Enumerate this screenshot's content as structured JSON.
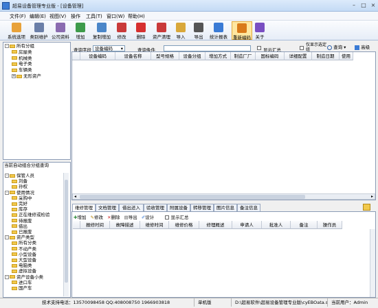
{
  "window": {
    "title": "超易设备管理专业版 - [设备管理]",
    "controls": [
      "–",
      "□",
      "×"
    ]
  },
  "menu": [
    "文件(F)",
    "编辑(E)",
    "视图(V)",
    "操作",
    "工具(T)",
    "窗口(W)",
    "帮助(H)"
  ],
  "toolbar": [
    {
      "label": "系统选项",
      "icon": "system-options-icon",
      "color": "#e8a23a"
    },
    {
      "label": "类别维护",
      "icon": "category-maintain-icon",
      "color": "#6b7fa8"
    },
    {
      "label": "公司资料",
      "icon": "company-info-icon",
      "color": "#8a6bb0"
    },
    {
      "label": "增加",
      "icon": "add-icon",
      "color": "#3d9b4b"
    },
    {
      "label": "复制增加",
      "icon": "copy-add-icon",
      "color": "#4a86c9"
    },
    {
      "label": "修改",
      "icon": "edit-icon",
      "color": "#c93a3a"
    },
    {
      "label": "删除",
      "icon": "delete-icon",
      "color": "#d63030"
    },
    {
      "label": "资产清理",
      "icon": "asset-clean-icon",
      "color": "#c93a3a"
    },
    {
      "label": "导入",
      "icon": "import-icon",
      "color": "#d9a83a"
    },
    {
      "label": "导出",
      "icon": "export-icon",
      "color": "#555555"
    },
    {
      "label": "统计报表",
      "icon": "report-icon",
      "color": "#3a7bd5"
    },
    {
      "label": "重新编码",
      "icon": "recode-icon",
      "color": "#d97a1a",
      "active": true
    },
    {
      "label": "关于",
      "icon": "help-icon",
      "color": "#7a4fc2"
    }
  ],
  "tree_top": [
    {
      "label": "所有分组",
      "level": 0,
      "exp": "-"
    },
    {
      "label": "房屋类",
      "level": 1
    },
    {
      "label": "机械类",
      "level": 1
    },
    {
      "label": "电子类",
      "level": 1
    },
    {
      "label": "车辆类",
      "level": 1
    },
    {
      "label": "无形资产",
      "level": 1,
      "exp": "+"
    }
  ],
  "tree_bottom_title": "当前自动组合分组查询",
  "tree_bottom": [
    {
      "label": "保管人员",
      "level": 0,
      "exp": "-"
    },
    {
      "label": "刘备",
      "level": 1
    },
    {
      "label": "孙权",
      "level": 1
    },
    {
      "label": "使用情况",
      "level": 0,
      "exp": "-"
    },
    {
      "label": "采购中",
      "level": 1
    },
    {
      "label": "完好",
      "level": 1
    },
    {
      "label": "库存",
      "level": 1
    },
    {
      "label": "正在维修或检验",
      "level": 1
    },
    {
      "label": "待报废",
      "level": 1
    },
    {
      "label": "借出",
      "level": 1
    },
    {
      "label": "已报废",
      "level": 1
    },
    {
      "label": "资产类型",
      "level": 0,
      "exp": "-"
    },
    {
      "label": "所有分类",
      "level": 1
    },
    {
      "label": "不动产类",
      "level": 1
    },
    {
      "label": "小型设备",
      "level": 1
    },
    {
      "label": "大型设备",
      "level": 1
    },
    {
      "label": "电脑类",
      "level": 1
    },
    {
      "label": "虚拟设备",
      "level": 1
    },
    {
      "label": "资产设备小类",
      "level": 0,
      "exp": "-"
    },
    {
      "label": "进口车",
      "level": 1
    },
    {
      "label": "国产车",
      "level": 1
    }
  ],
  "query": {
    "field_label": "查询字段",
    "field_value": "设备编码",
    "cond_label": "查询条件",
    "cond_value": "",
    "show_summary": "显示汇总",
    "only_selected": "仅显示选定组",
    "search_button": "查询",
    "advanced_button": "高级"
  },
  "main_columns": [
    "设备编码",
    "设备名称",
    "型号规格",
    "设备分组",
    "增加方式",
    "制造厂厂",
    "国标编码",
    "详细配置",
    "制造日期",
    "使用"
  ],
  "tabs": [
    "维修管理",
    "文档管理",
    "借出还入",
    "验收管理",
    "附属设备",
    "转移管理",
    "图片信息",
    "备注信息"
  ],
  "sub_toolbar": {
    "add": "增加",
    "edit": "修改",
    "delete": "删除",
    "export": "导出",
    "design": "设计",
    "show_summary": "显示汇总"
  },
  "sub_columns": [
    "报修时间",
    "故障描述",
    "维修时间",
    "维修价格",
    "修理概述",
    "申请人",
    "批准人",
    "备注",
    "操作员"
  ],
  "status": {
    "support": "技术支持电话：13570098458 QQ:408008750 1966903818",
    "mode": "单机版",
    "path": "D:\\超易软件\\超易设备管理专业版\\cyEBOata.sys",
    "user": "当前用户：Admin"
  }
}
